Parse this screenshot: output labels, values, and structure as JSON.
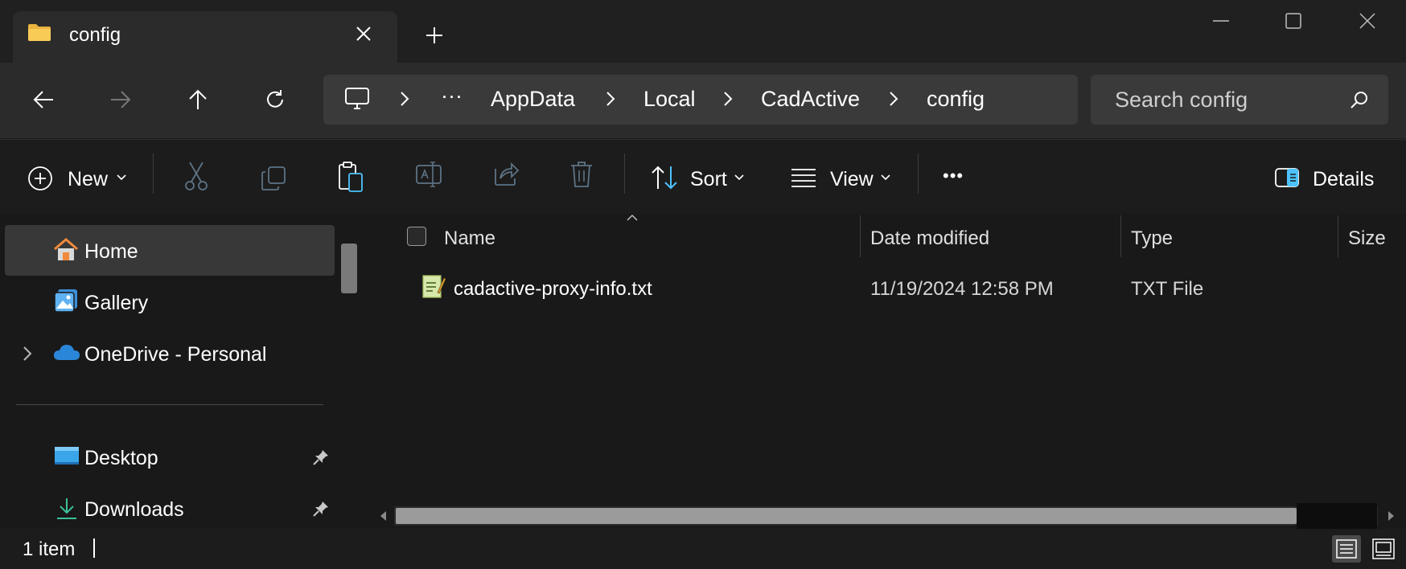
{
  "tab": {
    "title": "config",
    "icon": "folder-icon"
  },
  "window": {
    "minimize_icon": "minimize-icon",
    "maximize_icon": "maximize-icon",
    "close_icon": "close-icon"
  },
  "nav": {
    "back_icon": "back-arrow-icon",
    "forward_icon": "forward-arrow-icon",
    "up_icon": "up-arrow-icon",
    "refresh_icon": "refresh-icon"
  },
  "breadcrumb": {
    "ellipsis": "···",
    "items": [
      "AppData",
      "Local",
      "CadActive",
      "config"
    ]
  },
  "search": {
    "placeholder": "Search config"
  },
  "toolbar": {
    "new_label": "New",
    "sort_label": "Sort",
    "view_label": "View",
    "more_label": "•••",
    "details_label": "Details"
  },
  "sidebar": {
    "items": [
      {
        "label": "Home"
      },
      {
        "label": "Gallery"
      },
      {
        "label": "OneDrive - Personal"
      },
      {
        "label": "Desktop"
      },
      {
        "label": "Downloads"
      }
    ]
  },
  "columns": {
    "name": "Name",
    "date": "Date modified",
    "type": "Type",
    "size": "Size"
  },
  "files": [
    {
      "name": "cadactive-proxy-info.txt",
      "date": "11/19/2024 12:58 PM",
      "type": "TXT File",
      "size": ""
    }
  ],
  "status": {
    "count": "1 item"
  },
  "colors": {
    "background": "#1c1c1c",
    "accent": "#4cc2ff",
    "selection": "#383838"
  }
}
